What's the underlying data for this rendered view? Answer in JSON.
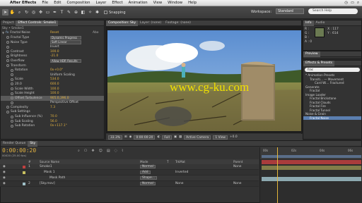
{
  "menubar": {
    "app": "After Effects",
    "items": [
      "File",
      "Edit",
      "Composition",
      "Layer",
      "Effect",
      "Animation",
      "View",
      "Window",
      "Help"
    ],
    "clock_icon": "clock-icon",
    "battery_icon": "battery-icon"
  },
  "toolbar": {
    "snapping_label": "Snapping",
    "workspace_label": "Workspace:",
    "workspace_value": "Standard",
    "search_placeholder": "Search Help"
  },
  "left_panel": {
    "tabs": [
      "Project",
      "Effect Controls: Smoke1"
    ],
    "path": "Sky • Smoke1",
    "effect_name": "Fractal Noise",
    "reset_label": "Reset",
    "about_label": "Abo",
    "rows": [
      {
        "label": "Fractal Type",
        "value": "Dynamic Progress",
        "dd": true
      },
      {
        "label": "Noise Type",
        "value": "Soft Linear",
        "dd": true
      },
      {
        "label": "",
        "value": "Invert",
        "check": true
      },
      {
        "label": "Contrast",
        "value": "100.0"
      },
      {
        "label": "Brightness",
        "value": "-21.0"
      },
      {
        "label": "Overflow",
        "value": "Allow HDR Results",
        "dd": true
      },
      {
        "label": "Transform",
        "value": ""
      },
      {
        "label": "Rotation",
        "value": "0x+0.0°"
      },
      {
        "label": "",
        "value": "Uniform Scaling",
        "check": true
      },
      {
        "label": "Scale",
        "value": "534.0"
      },
      {
        "label": "20.0",
        "value": "600.0"
      },
      {
        "label": "Scale Width",
        "value": "100.0"
      },
      {
        "label": "Scale Height",
        "value": "100.0"
      },
      {
        "label": "Offset Turbulence",
        "value": "905.0,396.0"
      },
      {
        "label": "",
        "value": "Perspective Offset",
        "check": true
      },
      {
        "label": "Complexity",
        "value": "7.3"
      },
      {
        "label": "Sub Settings",
        "value": ""
      },
      {
        "label": "Sub Influence (%)",
        "value": "70.0"
      },
      {
        "label": "Sub Scaling",
        "value": "56.0"
      },
      {
        "label": "Sub Rotation",
        "value": "0x+117.1°"
      }
    ]
  },
  "composition": {
    "tabs": [
      "Composition: Sky",
      "Layer: (none)",
      "Footage: (none)"
    ],
    "watermark": "www.cg-ku.com",
    "zoom": "33.3%",
    "timecode": "0:00:00:20",
    "resolution": "Full",
    "camera": "Active Camera",
    "view": "1 View",
    "offset": "+0.0"
  },
  "info_panel": {
    "tabs": [
      "Info",
      "Audio"
    ],
    "rgb": [
      "R :",
      "G :",
      "B :",
      "A : 0"
    ],
    "xy": [
      "X : 117",
      "Y : 614"
    ]
  },
  "preview_panel": {
    "tab": "Preview"
  },
  "effects_panel": {
    "tab": "Effects & Presets",
    "search_value": "frac",
    "items": [
      {
        "label": "* Animation Presets",
        "level": 0
      },
      {
        "label": "Transiti... — Movement",
        "level": 1
      },
      {
        "label": "Card Wi... Fractured",
        "level": 2
      },
      {
        "label": "Generate",
        "level": 0
      },
      {
        "label": "Fractal",
        "level": 1
      },
      {
        "label": "Image Loader",
        "level": 0
      },
      {
        "label": "Fractal Brickstone",
        "level": 1
      },
      {
        "label": "Fractal Clouds",
        "level": 1
      },
      {
        "label": "Fractal Fire",
        "level": 1
      },
      {
        "label": "Fractal Tunnel",
        "level": 1
      },
      {
        "label": "Noise & Grain",
        "level": 0
      },
      {
        "label": "Fractal Noise",
        "level": 1,
        "highlight": true
      }
    ]
  },
  "timeline": {
    "tabs": [
      "Render Queue",
      "Sky"
    ],
    "timecode": "0:00:00:20",
    "sub": "00020 (25.00 fps)",
    "headers": [
      "#",
      "Source Name",
      "Mode",
      "T",
      "TrkMat",
      "Parent"
    ],
    "layers": [
      {
        "num": "1",
        "name": "Smoke1",
        "mode": "Normal",
        "trk": "",
        "parent": "None",
        "color": "#c04040"
      },
      {
        "num": "",
        "name": "Mask 1",
        "mode": "Add",
        "trk": "Inverted",
        "parent": "",
        "color": "#c8c060"
      },
      {
        "num": "",
        "name": "Mask Path",
        "mode": "Shape...",
        "trk": "",
        "parent": "",
        "color": ""
      },
      {
        "num": "2",
        "name": "[Sky.mov]",
        "mode": "Normal",
        "trk": "None",
        "parent": "None",
        "color": "#9fc0c8"
      }
    ],
    "ruler": [
      "00s",
      "02s",
      "04s",
      "06s"
    ]
  }
}
